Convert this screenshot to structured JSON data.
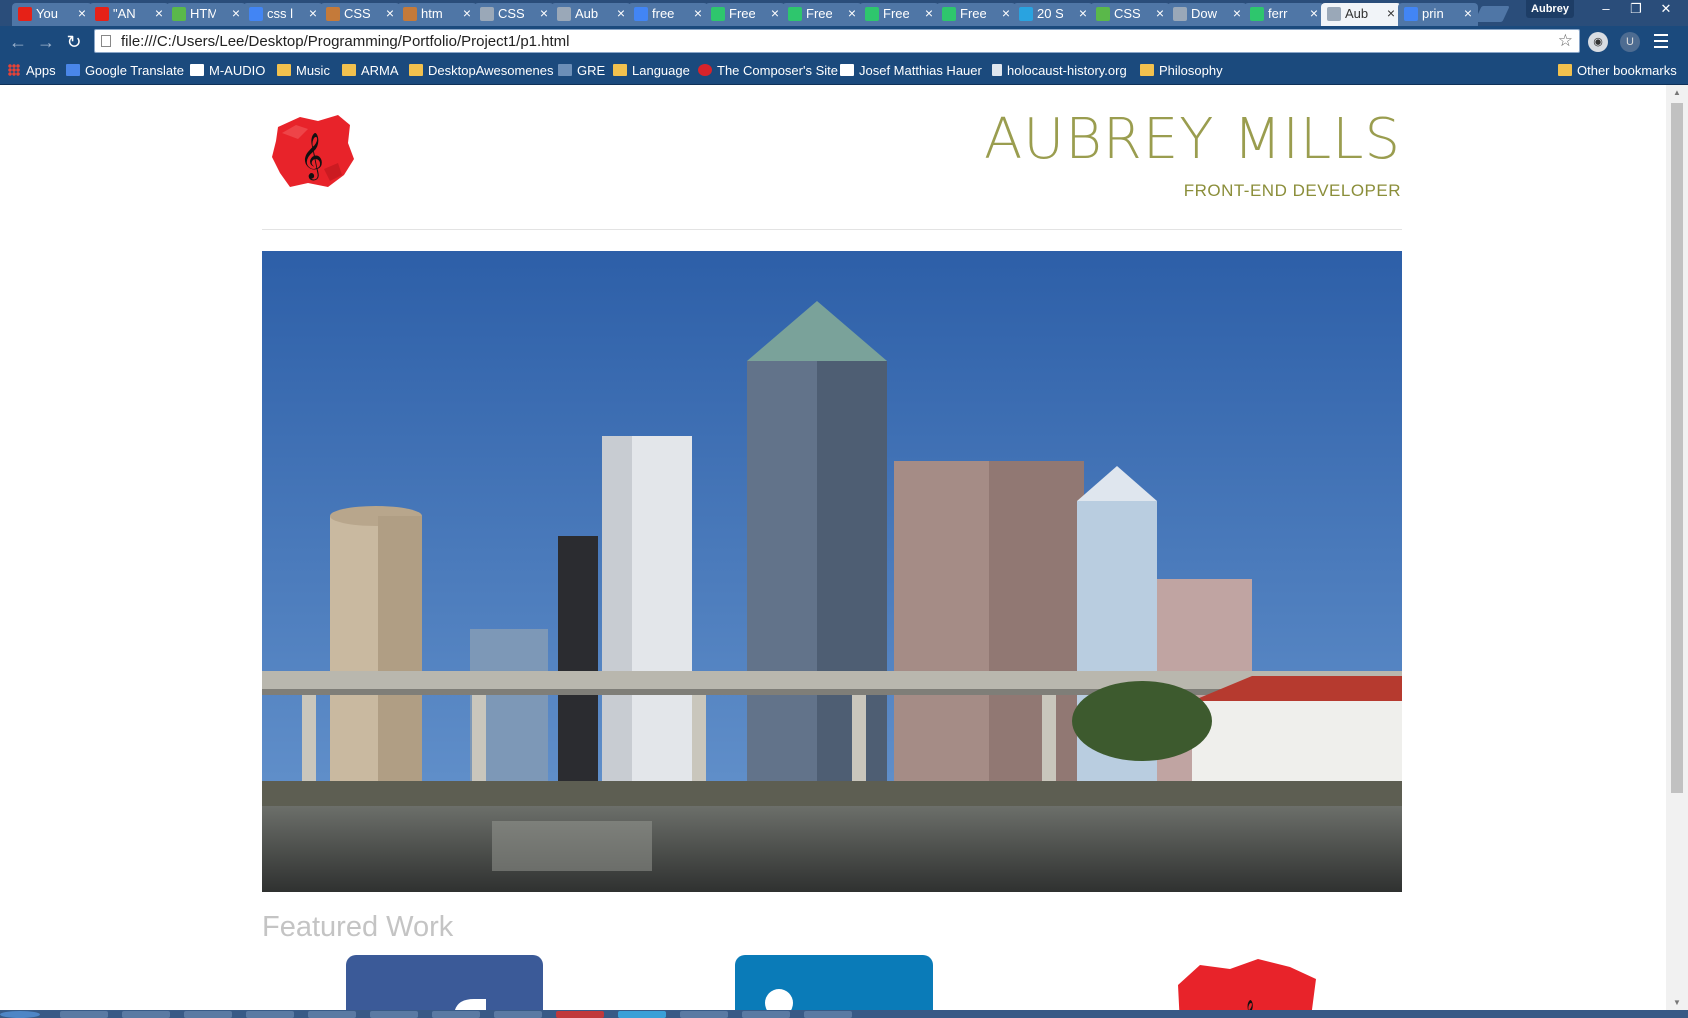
{
  "browser": {
    "tabs": [
      {
        "title": "You",
        "icon": "youtube-icon",
        "color": "#e62117"
      },
      {
        "title": "\"AN",
        "icon": "youtube-icon",
        "color": "#e62117"
      },
      {
        "title": "HTM",
        "icon": "w3schools-icon",
        "color": "#5ab84a"
      },
      {
        "title": "css l",
        "icon": "google-icon",
        "color": "#4285f4"
      },
      {
        "title": "CSS",
        "icon": "stackoverflow-icon",
        "color": "#c47a3a"
      },
      {
        "title": "htm",
        "icon": "stackoverflow-icon",
        "color": "#c47a3a"
      },
      {
        "title": "CSS",
        "icon": "page-icon",
        "color": "#9aa8b8"
      },
      {
        "title": "Aub",
        "icon": "page-icon",
        "color": "#9aa8b8"
      },
      {
        "title": "free",
        "icon": "google-icon",
        "color": "#4285f4"
      },
      {
        "title": "Free",
        "icon": "pixabay-icon",
        "color": "#2ec66d"
      },
      {
        "title": "Free",
        "icon": "pixabay-icon",
        "color": "#2ec66d"
      },
      {
        "title": "Free",
        "icon": "pixabay-icon",
        "color": "#2ec66d"
      },
      {
        "title": "Free",
        "icon": "pixabay-icon",
        "color": "#2ec66d"
      },
      {
        "title": "20 S",
        "icon": "recycle-icon",
        "color": "#29a3e0"
      },
      {
        "title": "CSS",
        "icon": "w3schools-icon",
        "color": "#5ab84a"
      },
      {
        "title": "Dow",
        "icon": "download-icon",
        "color": "#9aa8b8"
      },
      {
        "title": "ferr",
        "icon": "pixabay-icon",
        "color": "#2ec66d"
      },
      {
        "title": "Aub",
        "icon": "page-icon",
        "color": "#9aa8b8",
        "active": true
      },
      {
        "title": "prin",
        "icon": "google-icon",
        "color": "#4285f4"
      }
    ],
    "profile_name": "Aubrey",
    "url": "file:///C:/Users/Lee/Desktop/Programming/Portfolio/Project1/p1.html",
    "bookmarks": [
      {
        "label": "Apps",
        "icon": "apps-grid-icon"
      },
      {
        "label": "Google Translate",
        "icon": "google-translate-icon"
      },
      {
        "label": "M-AUDIO",
        "icon": "m-audio-icon"
      },
      {
        "label": "Music",
        "icon": "folder-icon"
      },
      {
        "label": "ARMA",
        "icon": "folder-icon"
      },
      {
        "label": "DesktopAwesomenes",
        "icon": "folder-icon"
      },
      {
        "label": "GRE",
        "icon": "gre-icon"
      },
      {
        "label": "Language",
        "icon": "folder-icon"
      },
      {
        "label": "The Composer's Site",
        "icon": "composer-site-icon"
      },
      {
        "label": "Josef Matthias Hauer",
        "icon": "wikipedia-icon"
      },
      {
        "label": "holocaust-history.org",
        "icon": "page-icon"
      },
      {
        "label": "Philosophy",
        "icon": "folder-icon"
      },
      {
        "label": "Other bookmarks",
        "icon": "folder-icon"
      }
    ]
  },
  "site": {
    "name": "AUBREY MILLS",
    "role": "FRONT-END DEVELOPER",
    "hero_alt": "Tampa skyline over the river",
    "featured_heading": "Featured Work"
  },
  "colors": {
    "name": "#9a9d4f",
    "role": "#8b8e3a",
    "featured": "#c4c4c4",
    "chrome_frame": "#2a4d7a",
    "logo_red": "#e8232a"
  }
}
